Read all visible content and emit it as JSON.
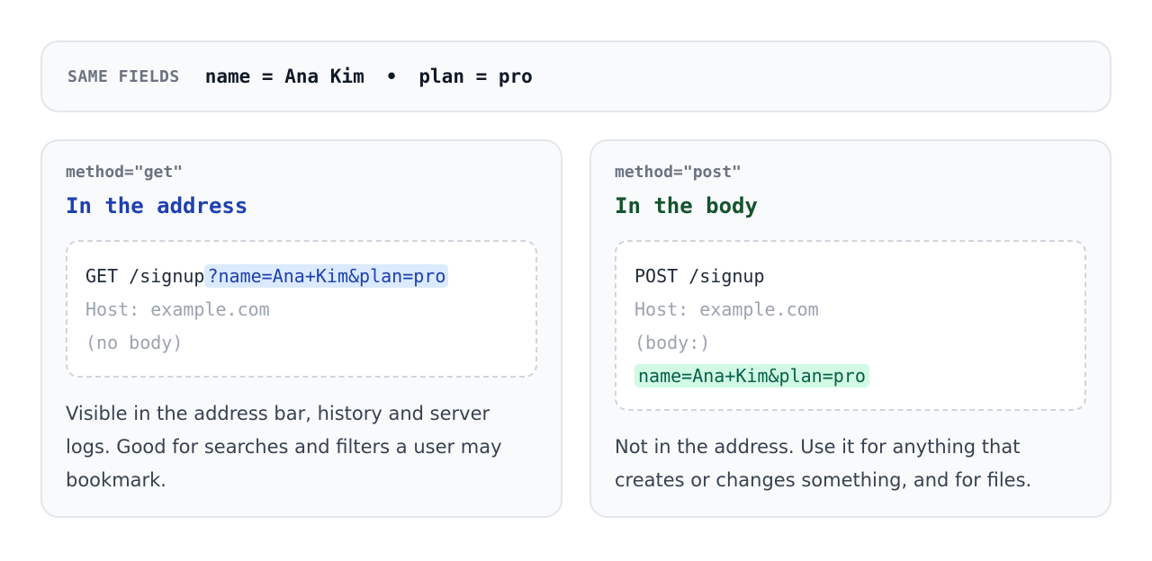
{
  "fields_bar": {
    "label": "SAME FIELDS",
    "field_1": "name = Ana Kim",
    "separator": "•",
    "field_2": "plan = pro"
  },
  "get_card": {
    "method": "method=\"get\"",
    "title": "In the address",
    "request": {
      "line1_prefix": "GET /signup",
      "line1_query": "?name=Ana+Kim&plan=pro",
      "host": "Host: example.com",
      "body_note": "(no body)"
    },
    "description": "Visible in the address bar, history and server logs. Good for searches and filters a user may bookmark."
  },
  "post_card": {
    "method": "method=\"post\"",
    "title": "In the body",
    "request": {
      "line1": "POST /signup",
      "host": "Host: example.com",
      "body_label": "(body:)",
      "body": "name=Ana+Kim&plan=pro"
    },
    "description": "Not in the address. Use it for anything that creates or changes something, and for files."
  },
  "colors": {
    "get_accent": "#1e40af",
    "get_highlight": "#dbeafe",
    "post_accent": "#14532d",
    "post_highlight": "#d1fae5"
  }
}
